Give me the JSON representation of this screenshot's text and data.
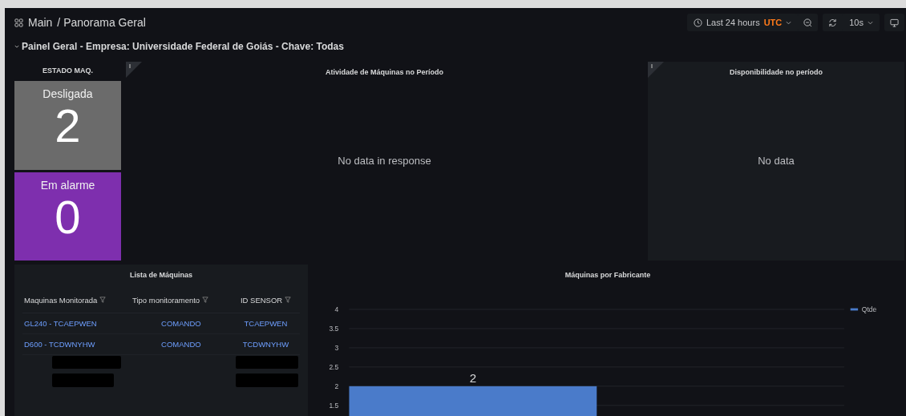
{
  "breadcrumb": {
    "home": "Main",
    "page": "/ Panorama Geral"
  },
  "toolbar": {
    "time_range": "Last 24 hours",
    "timezone": "UTC",
    "refresh_interval": "10s"
  },
  "row": {
    "title": "Painel Geral - Empresa: Universidade Federal de Goiás - Chave: Todas",
    "expanded": true
  },
  "status_panel": {
    "title": "ESTADO MAQ.",
    "stats": [
      {
        "label": "Desligada",
        "value": "2",
        "color": "#6b6b6b"
      },
      {
        "label": "Em alarme",
        "value": "0",
        "color": "#7e2fae"
      }
    ]
  },
  "activity_panel": {
    "title": "Atividade de Máquinas no Período",
    "message": "No data in response"
  },
  "availability_panel": {
    "title": "Disponibilidade no período",
    "message": "No data"
  },
  "machines_table": {
    "title": "Lista de Máquinas",
    "columns": [
      "Maquinas Monitorada",
      "Tipo monitoramento",
      "ID SENSOR"
    ],
    "rows": [
      [
        "GL240 - TCAEPWEN",
        "COMANDO",
        "TCAEPWEN"
      ],
      [
        "D600 - TCDWNYHW",
        "COMANDO",
        "TCDWNYHW"
      ]
    ]
  },
  "manufacturer_panel": {
    "title": "Máquinas por Fabricante",
    "chart_data": {
      "type": "bar",
      "grid": true,
      "ylim": [
        1,
        4
      ],
      "yticks": [
        1.5,
        2,
        2.5,
        3,
        3.5,
        4
      ],
      "data_labels": true,
      "series": [
        {
          "name": "Qtde",
          "color": "#4a7bca",
          "values": [
            2,
            null
          ]
        }
      ]
    }
  }
}
